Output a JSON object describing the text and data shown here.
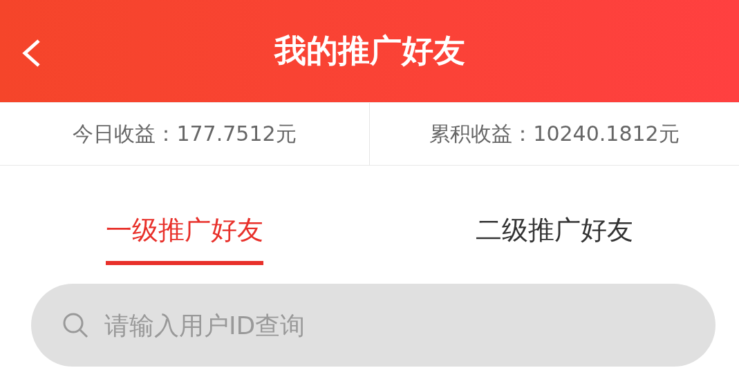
{
  "header": {
    "title": "我的推广好友"
  },
  "stats": [
    {
      "label": "今日收益：177.7512元"
    },
    {
      "label": "累积收益：10240.1812元"
    }
  ],
  "tabs": [
    {
      "label": "一级推广好友",
      "selected": true
    },
    {
      "label": "二级推广好友",
      "selected": false
    }
  ],
  "search": {
    "placeholder": "请输入用户ID查询"
  }
}
